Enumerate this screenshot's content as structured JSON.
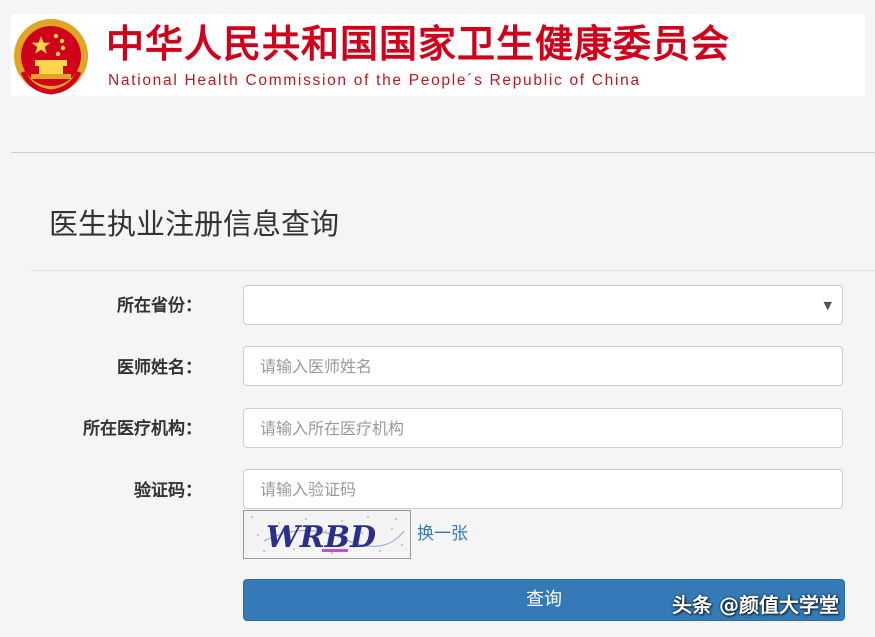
{
  "header": {
    "title_cn": "中华人民共和国国家卫生健康委员会",
    "title_en": "National Health Commission of the People´s Republic of China",
    "emblem_icon": "national-emblem-icon"
  },
  "panel": {
    "title": "医生执业注册信息查询"
  },
  "form": {
    "province": {
      "label": "所在省份：",
      "value": ""
    },
    "doctor_name": {
      "label": "医师姓名：",
      "placeholder": "请输入医师姓名",
      "value": ""
    },
    "institution": {
      "label": "所在医疗机构：",
      "placeholder": "请输入所在医疗机构",
      "value": ""
    },
    "captcha": {
      "label": "验证码：",
      "placeholder": "请输入验证码",
      "value": "",
      "image_text": "WRBD",
      "refresh_label": "换一张"
    },
    "submit_label": "查询"
  },
  "watermark": "头条 @颜值大学堂",
  "colors": {
    "brand_red": "#d0021b",
    "button_blue": "#337ab7",
    "link_blue": "#337ab7"
  }
}
